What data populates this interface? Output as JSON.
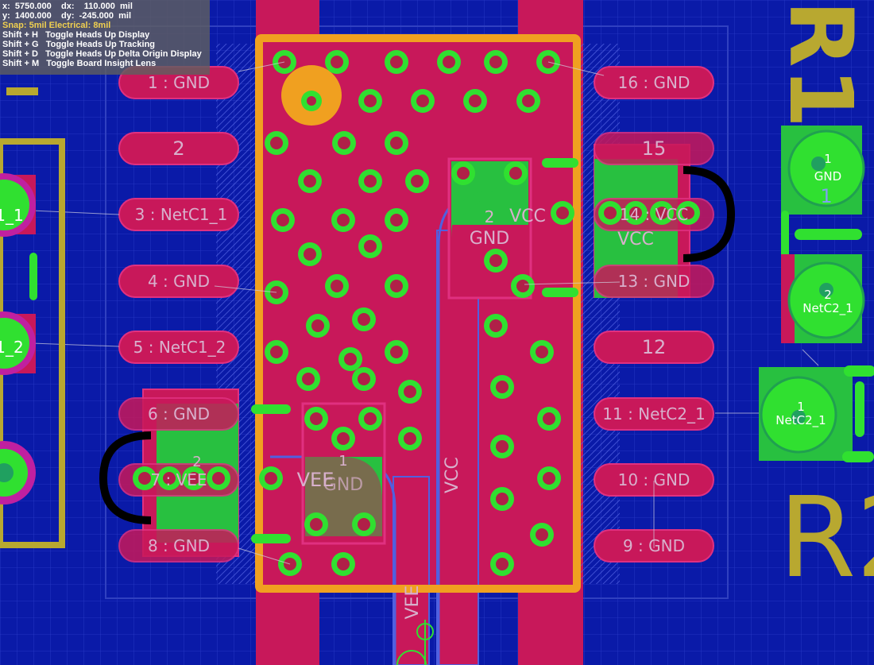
{
  "hud": {
    "line1": "x:  5750.000    dx:    110.000  mil",
    "line2": "y:  1400.000    dy:  -245.000  mil",
    "snap": "Snap: 5mil Electrical: 8mil",
    "shortcuts": [
      "Shift + H   Toggle Heads Up Display",
      "Shift + G   Toggle Heads Up Tracking",
      "Shift + D   Toggle Heads Up Delta Origin Display",
      "Shift + M   Toggle Board Insight Lens"
    ]
  },
  "pads_left": [
    "1 : GND",
    "2",
    "3 : NetC1_1",
    "4 : GND",
    "5 : NetC1_2",
    "6 : GND",
    "7 : VEE",
    "8 : GND"
  ],
  "pads_right": [
    "16 : GND",
    "15",
    "14 : VCC",
    "13 : GND",
    "12",
    "11 : NetC2_1",
    "10 : GND",
    "9 : GND"
  ],
  "net_labels": {
    "vcc_top_small": "VCC",
    "gnd_top_small": "GND",
    "vcc_right_big": "VCC",
    "vcc_right_overlay": "14 : VCC",
    "vee_left_overlay": "VEE",
    "vee_center": "VEE",
    "gnd_center": "GND",
    "vcc_vertical": "VCC",
    "vee_vertical": "VEE"
  },
  "component_pads": {
    "cap_top_num": "2",
    "cap_center_num": "1",
    "cap_left_num": "2",
    "cap_right_num": "1"
  },
  "side_pads": {
    "left_top": "1_1",
    "left_bottom": "1_2",
    "right_top_num": "1",
    "right_top_net": "GND",
    "right_top_ghost": "1",
    "right_mid_num": "2",
    "right_mid_net": "NetC2_1",
    "right_low_num": "1",
    "right_low_net": "NetC2_1"
  },
  "designators": {
    "top": "R1",
    "bottom": "R2"
  },
  "colors": {
    "board": "#0a1aa8",
    "grid": "#2a3cc8",
    "copper_top": "#c8185a",
    "copper_bottom": "#4a52d8",
    "keepout": "#f0a020",
    "silkscreen": "#b8a830",
    "pad_green": "#30e030",
    "via_hole": "#b02048",
    "hud_bg": "#5f5f5f"
  }
}
